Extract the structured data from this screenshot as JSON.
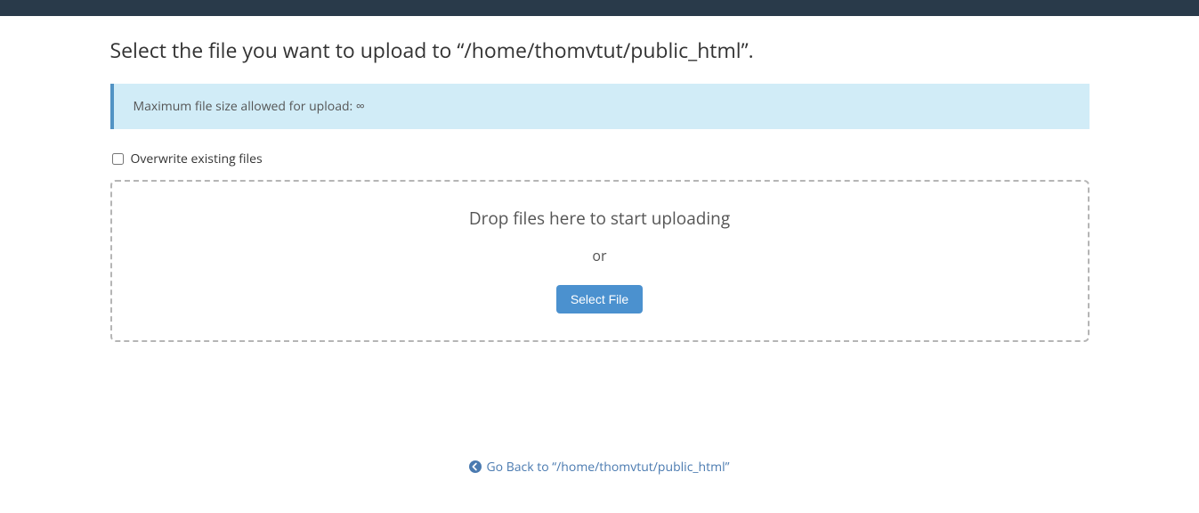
{
  "page": {
    "title": "Select the file you want to upload to “/home/thomvtut/public_html”."
  },
  "info": {
    "message": "Maximum file size allowed for upload: ∞"
  },
  "overwrite": {
    "label": "Overwrite existing files"
  },
  "dropzone": {
    "title": "Drop files here to start uploading",
    "or": "or",
    "button": "Select File"
  },
  "back": {
    "label": "Go Back to “/home/thomvtut/public_html”"
  }
}
